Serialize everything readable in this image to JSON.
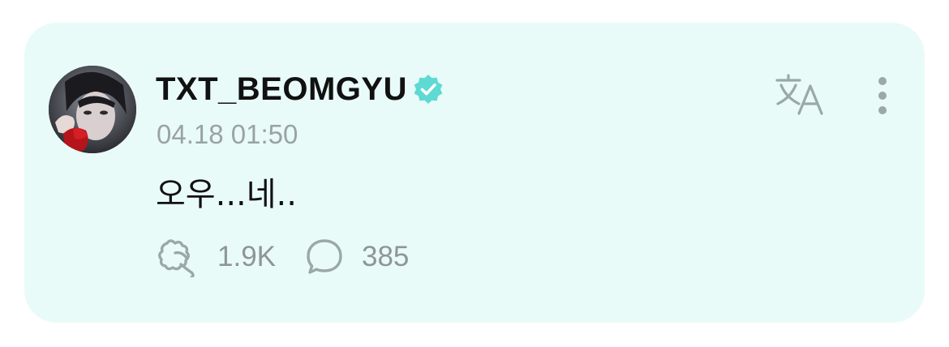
{
  "post": {
    "author": "TXT_BEOMGYU",
    "verified": true,
    "timestamp": "04.18 01:50",
    "body": "오우...네..",
    "reactions_count": "1.9K",
    "comments_count": "385"
  },
  "icons": {
    "verified": "verified-badge-icon",
    "translate": "translate-icon",
    "more": "more-vertical-icon",
    "reaction": "cheer-reaction-icon",
    "comment": "comment-bubble-icon"
  },
  "colors": {
    "card_background": "#e9fbf8",
    "verified_badge": "#5fd9d3",
    "muted_text": "#9aa3a1",
    "icon_gray": "#9aa8a6"
  }
}
